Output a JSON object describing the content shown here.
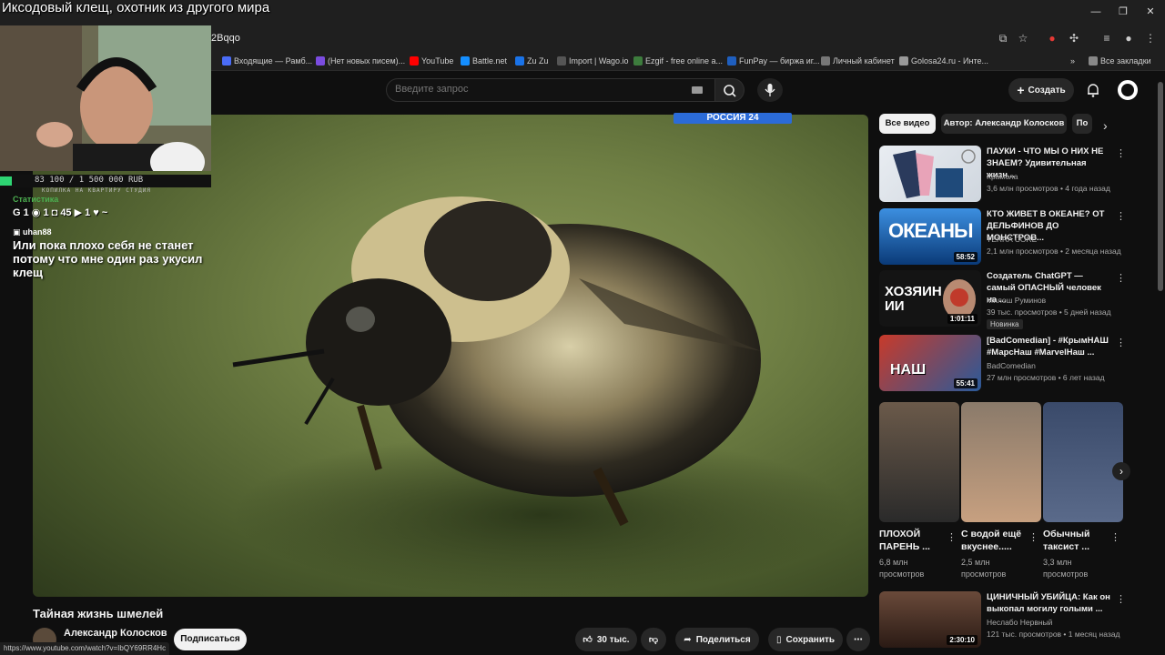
{
  "stream": {
    "title": "Иксодовый клещ, охотник из другого мира"
  },
  "browser": {
    "url_fragment": "2Bqqo",
    "status_url": "https://www.youtube.com/watch?v=IbQY69RR4Hc",
    "bookmarks": [
      {
        "label": "Входящие — Рамб...",
        "color": "#4a6cf7"
      },
      {
        "label": "(Нет новых писем)...",
        "color": "#7b4ce0"
      },
      {
        "label": "YouTube",
        "color": "#ff0000"
      },
      {
        "label": "Battle.net",
        "color": "#148eff"
      },
      {
        "label": "Zu Zu",
        "color": "#1a73e8"
      },
      {
        "label": "Import | Wago.io",
        "color": "#222222"
      },
      {
        "label": "Ezgif - free online a...",
        "color": "#3d7c3d"
      },
      {
        "label": "FunPay — биржа иг...",
        "color": "#1f5fbf"
      },
      {
        "label": "Личный кабинет",
        "color": "#777777"
      },
      {
        "label": "Golosa24.ru - Инте...",
        "color": "#999999"
      }
    ],
    "all_bookmarks": "Все закладки"
  },
  "header": {
    "search_placeholder": "Введите запрос",
    "create_label": "Создать"
  },
  "video": {
    "overlay_logo": "РОССИЯ 24",
    "title": "Тайная жизнь шмелей",
    "channel": "Александр Колосков",
    "subscribe": "Подписаться",
    "likes": "30 тыс.",
    "share": "Поделиться",
    "save": "Сохранить"
  },
  "overlay": {
    "counter": "83 100 / 1 500 000 RUB",
    "counter_progress": 0.055,
    "caption": "КОПИЛКА НА КВАРТИРУ СТУДИЯ",
    "stats_title": "Статистика",
    "stats_line": "G 1  ◉ 1  ◘ 45  ▶ 1  ♥ ~",
    "chat_user": "uhan88",
    "chat_message": "Или пока плохо себя не станет потому что мне один раз укусил клещ"
  },
  "chips": [
    "Все видео",
    "Автор: Александр Колосков",
    "По"
  ],
  "recommendations": [
    {
      "title": "ПАУКИ - ЧТО МЫ О НИХ НЕ ЗНАЕМ? Удивительная жизн...",
      "channel": "Крамола",
      "meta": "3,6 млн просмотров • 4 года назад",
      "duration": ""
    },
    {
      "title": "КТО ЖИВЕТ В ОКЕАНЕ? ОТ ДЕЛЬФИНОВ ДО МОНСТРОВ...",
      "channel": "TERRA CORE",
      "meta": "2,1 млн просмотров • 2 месяца назад",
      "duration": "58:52",
      "thumb_text": "ОКЕАНЫ"
    },
    {
      "title": "Создатель ChatGPT — самый ОПАСНЫЙ человек на ...",
      "channel": "Милош Руминов",
      "meta": "39 тыс. просмотров • 5 дней назад",
      "duration": "1:01:11",
      "thumb_text": "ХОЗЯИН ИИ",
      "badge": "Новинка"
    },
    {
      "title": "[BadComedian] - #КрымНАШ #МарсНаш #MarvelНаш ...",
      "channel": "BadComedian",
      "meta": "27 млн просмотров • 6 лет назад",
      "duration": "55:41",
      "thumb_text": "НАШ"
    }
  ],
  "shorts": [
    {
      "title": "ПЛОХОЙ ПАРЕНЬ ...",
      "views": "6,8 млн просмотров"
    },
    {
      "title": "С водой ещё вкуснее.....",
      "views": "2,5 млн просмотров"
    },
    {
      "title": "Обычный таксист ...",
      "views": "3,3 млн просмотров"
    }
  ],
  "last_rec": {
    "title": "ЦИНИЧНЫЙ УБИЙЦА: Как он выкопал могилу голыми ...",
    "channel": "Неслабо Нервный",
    "meta": "121 тыс. просмотров • 1 месяц назад",
    "duration": "2:30:10"
  }
}
